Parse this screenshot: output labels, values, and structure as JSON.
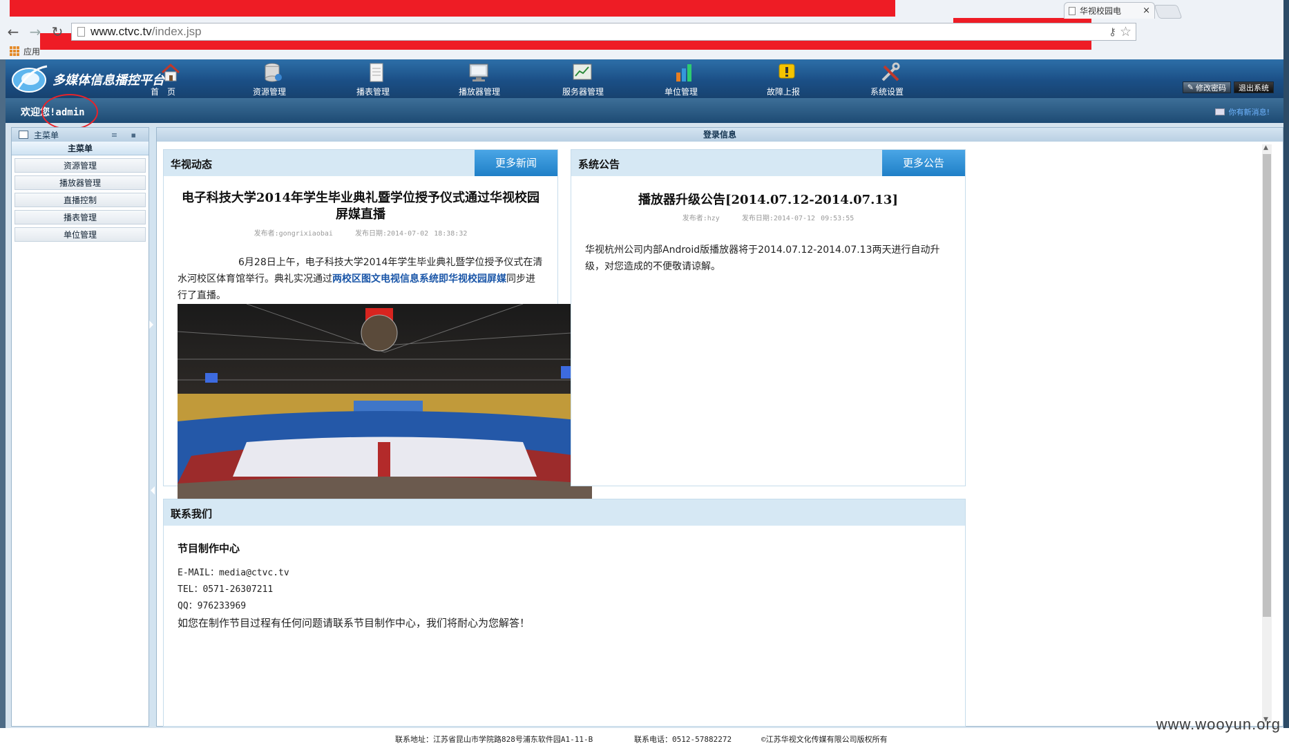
{
  "browser": {
    "tab_title": "华视校园电",
    "tab_close": "×",
    "url_host": "www.ctvc.tv",
    "url_path": "/index.jsp",
    "bookmarks_label": "应用"
  },
  "app": {
    "title": "多媒体信息播控平台",
    "nav": [
      {
        "label": "首　页"
      },
      {
        "label": "资源管理"
      },
      {
        "label": "播表管理"
      },
      {
        "label": "播放器管理"
      },
      {
        "label": "服务器管理"
      },
      {
        "label": "单位管理"
      },
      {
        "label": "故障上报"
      },
      {
        "label": "系统设置"
      }
    ],
    "change_password": "修改密码",
    "logout": "退出系统",
    "welcome": "欢迎您!admin",
    "new_message": "你有新消息!"
  },
  "sidebar": {
    "header": "主菜单",
    "subheader": "主菜单",
    "items": [
      {
        "label": "资源管理"
      },
      {
        "label": "播放器管理"
      },
      {
        "label": "直播控制"
      },
      {
        "label": "播表管理"
      },
      {
        "label": "单位管理"
      }
    ]
  },
  "main": {
    "header": "登录信息",
    "news": {
      "title": "华视动态",
      "more": "更多新闻",
      "headline": "电子科技大学2014年学生毕业典礼暨学位授予仪式通过华视校园屏媒直播",
      "author": "发布者:gongrixiaobai",
      "date": "发布日期:2014-07-02 18:38:32",
      "body_before": "6月28日上午，电子科技大学2014年学生毕业典礼暨学位授予仪式在清水河校区体育馆举行。典礼实况通过",
      "body_link": "两校区图文电视信息系统即华视校园屏媒",
      "body_after": "同步进行了直播。"
    },
    "notice": {
      "title": "系统公告",
      "more": "更多公告",
      "headline": "播放器升级公告[2014.07.12-2014.07.13]",
      "author": "发布者:hzy",
      "date": "发布日期:2014-07-12 09:53:55",
      "body": "华视杭州公司内部Android版播放器将于2014.07.12-2014.07.13两天进行自动升级，对您造成的不便敬请谅解。"
    },
    "contact": {
      "title": "联系我们",
      "name": "节目制作中心",
      "email": "E-MAIL：media@ctvc.tv",
      "tel": "TEL：0571-26307211",
      "qq": "QQ：976233969",
      "note": "如您在制作节目过程有任何问题请联系节目制作中心，我们将耐心为您解答！"
    }
  },
  "footer": {
    "address": "联系地址：江苏省昆山市学院路828号浦东软件园A1-11-B",
    "phone": "联系电话：0512-57882272",
    "copyright": "©江苏华视文化传媒有限公司版权所有"
  },
  "watermark": "www.wooyun.org",
  "colors": {
    "redaction": "#ee1c25",
    "header_blue": "#1b4f86",
    "panel_head": "#d6e8f4",
    "more_button": "#1f7fc7",
    "link": "#1a56a8"
  }
}
